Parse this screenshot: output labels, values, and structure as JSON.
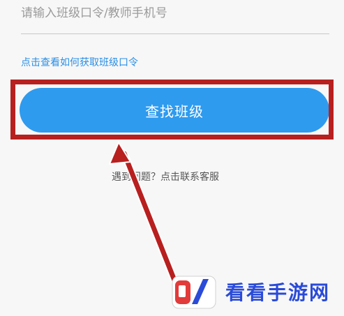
{
  "search": {
    "placeholder": "请输入班级口令/教师手机号",
    "value": ""
  },
  "help_link": {
    "label": "点击查看如何获取班级口令"
  },
  "find_button": {
    "label": "查找班级"
  },
  "contact": {
    "text": "遇到问题？点击联系客服"
  },
  "watermark": {
    "text": "看看手游网"
  },
  "colors": {
    "accent": "#2e9bef",
    "link": "#2a8fe6",
    "highlight": "#b81f1f",
    "watermark": "#2a4bd8"
  }
}
